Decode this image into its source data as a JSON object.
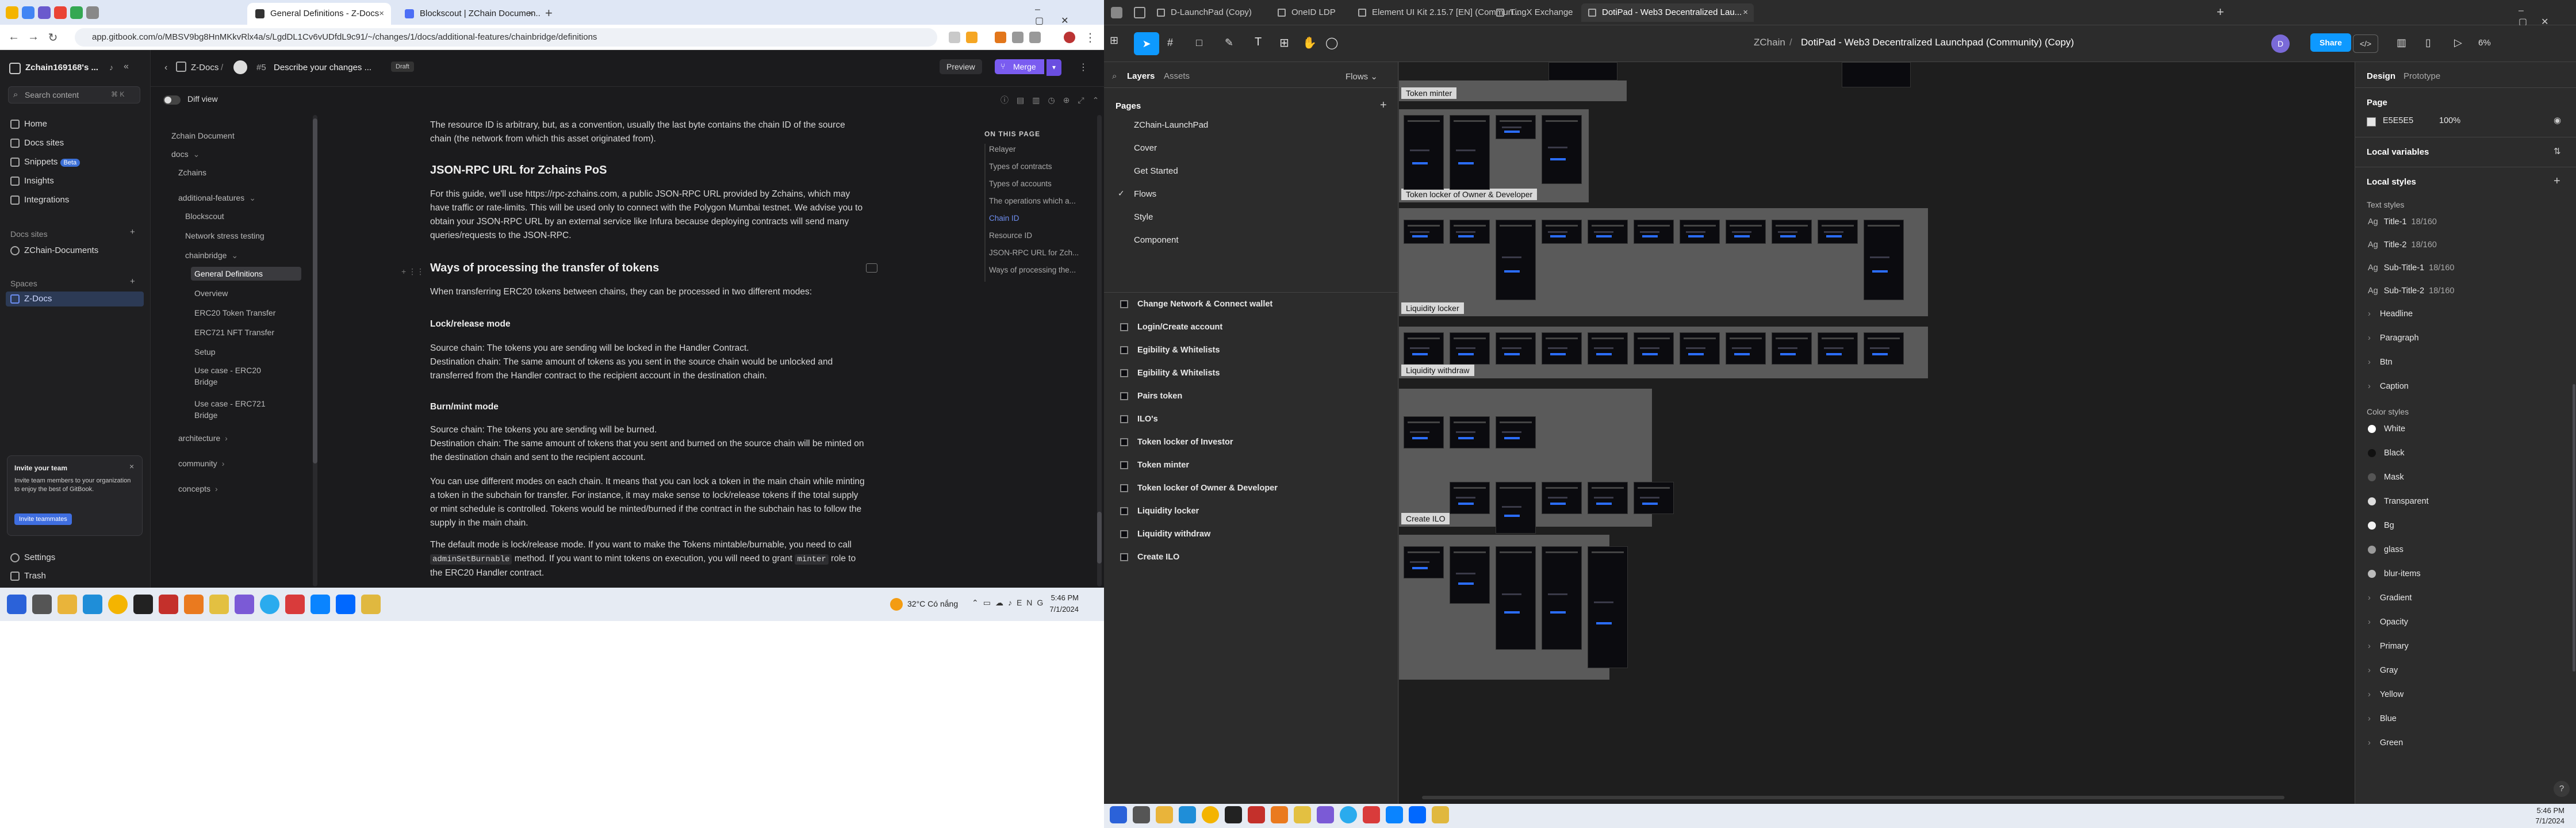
{
  "left": {
    "tabs": [
      {
        "title": "General Definitions - Z-Docs"
      },
      {
        "title": "Blockscout | ZChain Documen..."
      }
    ],
    "url": "app.gitbook.com/o/MBSV9bg8HnMKkvRlx4a/s/LgdDL1Cv6vUDfdL9c91/~/changes/1/docs/additional-features/chainbridge/definitions",
    "org": "Zchain169168's ...",
    "search_placeholder": "Search content",
    "search_kbd": "⌘ K",
    "nav": [
      "Home",
      "Docs sites",
      "Snippets",
      "Insights",
      "Integrations"
    ],
    "snippets_badge": "Beta",
    "docs_sites_heading": "Docs sites",
    "docs_site": "ZChain-Documents",
    "spaces_heading": "Spaces",
    "space": "Z-Docs",
    "invite": {
      "title": "Invite your team",
      "body": "Invite team members to your organization to enjoy the best of GitBook.",
      "button": "Invite teammates"
    },
    "bottom": [
      "Settings",
      "Trash"
    ],
    "breadcrumb": {
      "space": "Z-Docs",
      "change_no": "#5",
      "change_title": "Describe your changes ...",
      "status": "Draft"
    },
    "actions": {
      "preview": "Preview",
      "merge": "Merge"
    },
    "diff_view": "Diff view",
    "tree": [
      {
        "label": "Zchain Document",
        "indent": 0
      },
      {
        "label": "docs",
        "indent": 0,
        "chev": "⌄"
      },
      {
        "label": "Zchains",
        "indent": 1
      },
      {
        "label": "additional-features",
        "indent": 1,
        "chev": "⌄"
      },
      {
        "label": "Blockscout",
        "indent": 2
      },
      {
        "label": "Network stress testing",
        "indent": 2
      },
      {
        "label": "chainbridge",
        "indent": 2,
        "chev": "⌄"
      },
      {
        "label": "General Definitions",
        "indent": 3,
        "selected": true
      },
      {
        "label": "Overview",
        "indent": 3
      },
      {
        "label": "ERC20 Token Transfer",
        "indent": 3
      },
      {
        "label": "ERC721 NFT Transfer",
        "indent": 3
      },
      {
        "label": "Setup",
        "indent": 3
      },
      {
        "label": "Use case - ERC20",
        "indent": 3,
        "line2": "Bridge"
      },
      {
        "label": "Use case - ERC721",
        "indent": 3,
        "line2": "Bridge"
      },
      {
        "label": "architecture",
        "indent": 1,
        "chev": "›"
      },
      {
        "label": "community",
        "indent": 1,
        "chev": "›"
      },
      {
        "label": "concepts",
        "indent": 1,
        "chev": "›"
      }
    ],
    "content": {
      "p_resource": "The resource ID is arbitrary, but, as a convention, usually the last byte contains the chain ID of the source chain (the network from which this asset originated from).",
      "h_jsonrpc": "JSON-RPC URL for Zchains PoS",
      "p_jsonrpc": "For this guide, we'll use https://rpc-zchains.com, a public JSON-RPC URL provided by Zchains, which may have traffic or rate-limits. This will be used only to connect with the Polygon Mumbai testnet. We advise you to obtain your JSON-RPC URL by an external service like Infura because deploying contracts will send many queries/requests to the JSON-RPC.",
      "h_ways": "Ways of processing the transfer of tokens",
      "p_ways": "When transferring ERC20 tokens between chains, they can be processed in two different modes:",
      "h_lock": "Lock/release mode",
      "p_lock": "Source chain: The tokens you are sending will be locked in the Handler Contract.\nDestination chain: The same amount of tokens as you sent in the source chain would be unlocked and transferred from the Handler contract to the recipient account in the destination chain.",
      "h_burn": "Burn/mint mode",
      "p_burn": "Source chain: The tokens you are sending will be burned.\nDestination chain: The same amount of tokens that you sent and burned on the source chain will be minted on the destination chain and sent to the recipient account.",
      "p_modes": "You can use different modes on each chain. It means that you can lock a token in the main chain while minting a token in the subchain for transfer. For instance, it may make sense to lock/release tokens if the total supply or mint schedule is controlled. Tokens would be minted/burned if the contract in the subchain has to follow the supply in the main chain.",
      "p_default_a": "The default mode is lock/release mode. If you want to make the Tokens mintable/burnable, you need to call ",
      "code1": "adminSetBurnable",
      "p_default_b": " method. If you want to mint tokens on execution, you will need to grant ",
      "code2": "minter",
      "p_default_c": " role to the ERC20 Handler contract."
    },
    "toc_heading": "ON THIS PAGE",
    "toc": [
      "Relayer",
      "Types of contracts",
      "Types of accounts",
      "The operations which a...",
      "Chain ID",
      "Resource ID",
      "JSON-RPC URL for Zch...",
      "Ways of processing the..."
    ],
    "toc_active": 4,
    "taskbar": {
      "weather": "32°C  Có nắng",
      "time": "5:46 PM",
      "date": "7/1/2024"
    }
  },
  "right": {
    "tabs": [
      "D-LaunchPad (Copy)",
      "OneID LDP",
      "Element UI Kit 2.15.7 [EN] (Commun...",
      "TingX Exchange",
      "DotiPad - Web3 Decentralized Lau..."
    ],
    "title_team": "ZChain",
    "title_file": "DotiPad - Web3 Decentralized Launchpad (Community) (Copy)",
    "share": "Share",
    "zoom": "6%",
    "avatar": "D",
    "panel_tabs": [
      "Layers",
      "Assets"
    ],
    "flows_btn": "Flows",
    "pages_heading": "Pages",
    "pages": [
      "ZChain-LaunchPad",
      "Cover",
      "Get Started",
      "Flows",
      "Style",
      "Component"
    ],
    "current_page": 3,
    "layers": [
      "Change Network & Connect wallet",
      "Login/Create account",
      "Egibility & Whitelists",
      "Egibility & Whitelists",
      "Pairs token",
      "ILO's",
      "Token locker of Investor",
      "Token minter",
      "Token locker of Owner & Developer",
      "Liquidity locker",
      "Liquidity withdraw",
      "Create ILO"
    ],
    "sections": [
      "Token minter",
      "Token locker of Owner & Developer",
      "Liquidity locker",
      "Liquidity withdraw",
      "Create ILO"
    ],
    "design_tabs": [
      "Design",
      "Prototype"
    ],
    "page_heading": "Page",
    "page_fill": "E5E5E5",
    "page_opacity": "100%",
    "local_variables": "Local variables",
    "local_styles": "Local styles",
    "text_styles_heading": "Text styles",
    "text_styles": [
      {
        "name": "Title-1",
        "meta": "18/160"
      },
      {
        "name": "Title-2",
        "meta": "18/160"
      },
      {
        "name": "Sub-Title-1",
        "meta": "18/160"
      },
      {
        "name": "Sub-Title-2",
        "meta": "18/160"
      }
    ],
    "text_groups": [
      "Headline",
      "Paragraph",
      "Btn",
      "Caption"
    ],
    "color_styles_heading": "Color styles",
    "colors": [
      {
        "name": "White",
        "hex": "#ffffff"
      },
      {
        "name": "Black",
        "hex": "#111111"
      },
      {
        "name": "Mask",
        "hex": "#555555"
      },
      {
        "name": "Transparent",
        "hex": "#dddddd"
      },
      {
        "name": "Bg",
        "hex": "#f2f2f2"
      },
      {
        "name": "glass",
        "hex": "#9a9a9a"
      },
      {
        "name": "blur-items",
        "hex": "#bbbbbb"
      }
    ],
    "color_groups": [
      "Gradient",
      "Opacity",
      "Primary",
      "Gray",
      "Yellow",
      "Blue",
      "Green"
    ],
    "taskbar": {
      "time": "5:46 PM",
      "date": "7/1/2024"
    }
  }
}
